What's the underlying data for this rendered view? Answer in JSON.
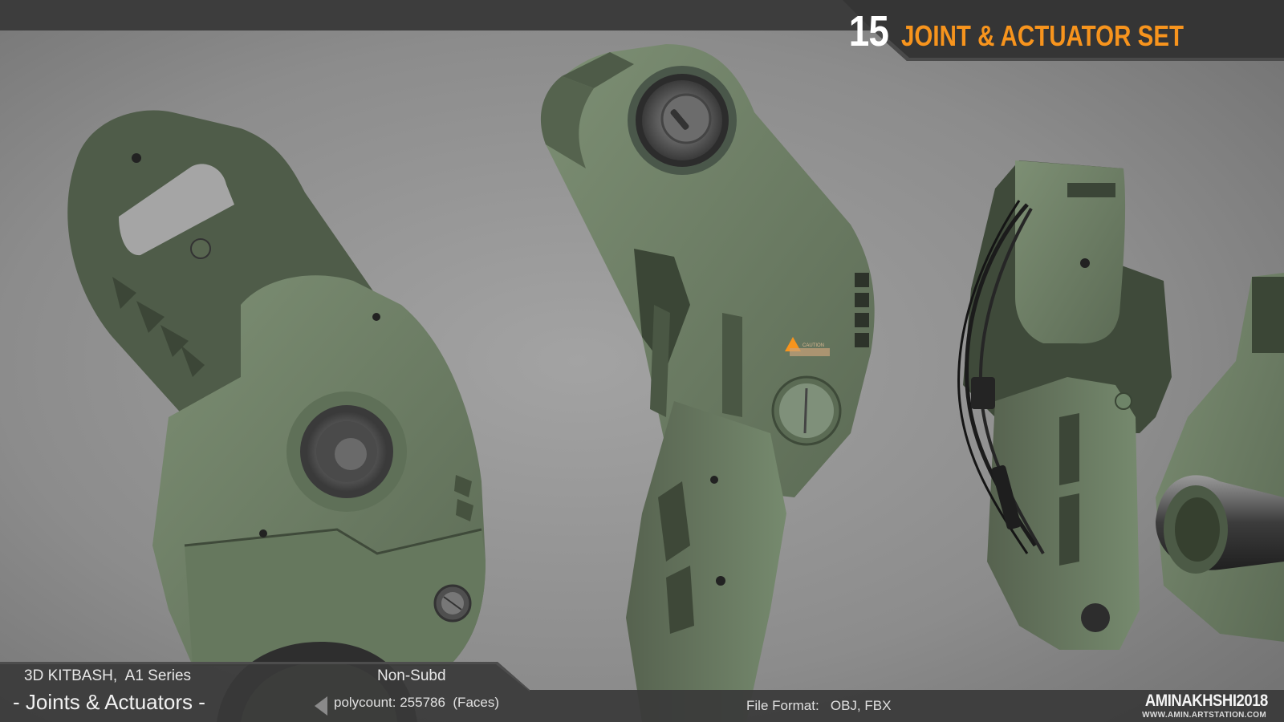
{
  "header": {
    "count": "15",
    "title": "JOINT & ACTUATOR SET"
  },
  "footer": {
    "series": "3D KITBASH,  A1 Series",
    "set_name": "- Joints & Actuators -",
    "subd": "Non-Subd",
    "polycount": "polycount: 255786  (Faces)",
    "file_format": "File Format:   OBJ, FBX",
    "author": "AMINAKHSHI2018",
    "website": "WWW.AMIN.ARTSTATION.COM"
  },
  "decal": {
    "caution": "CAUTION"
  },
  "colors": {
    "accent": "#f7941d",
    "banner": "#3a3a3a",
    "part_green": "#6f8267",
    "background": "#8a8a8a"
  }
}
